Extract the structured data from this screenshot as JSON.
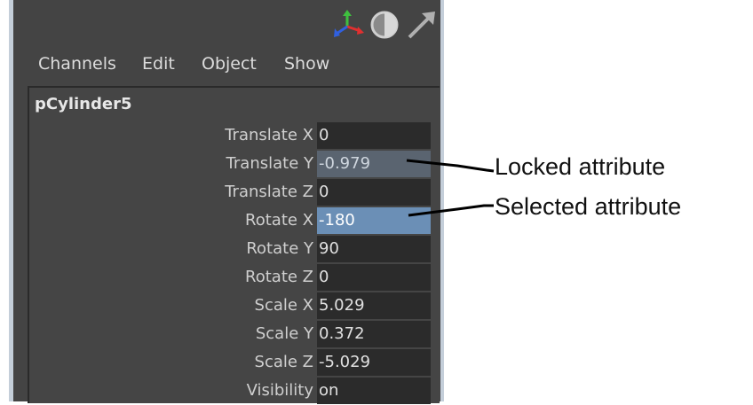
{
  "menu": {
    "items": [
      "Channels",
      "Edit",
      "Object",
      "Show"
    ]
  },
  "toolbar": {
    "icons": [
      "move-axes-icon",
      "half-circle-icon",
      "arrow-icon"
    ]
  },
  "channel_box": {
    "object_name": "pCylinder5",
    "attributes": [
      {
        "label": "Translate X",
        "value": "0",
        "state": "normal"
      },
      {
        "label": "Translate Y",
        "value": "-0.979",
        "state": "locked"
      },
      {
        "label": "Translate Z",
        "value": "0",
        "state": "normal"
      },
      {
        "label": "Rotate X",
        "value": "-180",
        "state": "selected"
      },
      {
        "label": "Rotate Y",
        "value": "90",
        "state": "normal"
      },
      {
        "label": "Rotate Z",
        "value": "0",
        "state": "normal"
      },
      {
        "label": "Scale X",
        "value": "5.029",
        "state": "normal"
      },
      {
        "label": "Scale Y",
        "value": "0.372",
        "state": "normal"
      },
      {
        "label": "Scale Z",
        "value": "-5.029",
        "state": "normal"
      },
      {
        "label": "Visibility",
        "value": "on",
        "state": "normal"
      }
    ]
  },
  "annotations": {
    "locked": "Locked attribute",
    "selected": "Selected attribute"
  },
  "colors": {
    "panel_bg": "#444444",
    "value_bg": "#2b2b2b",
    "locked_bg": "#5a6470",
    "selected_bg": "#6b8fb6",
    "frame": "#c4ced9"
  }
}
